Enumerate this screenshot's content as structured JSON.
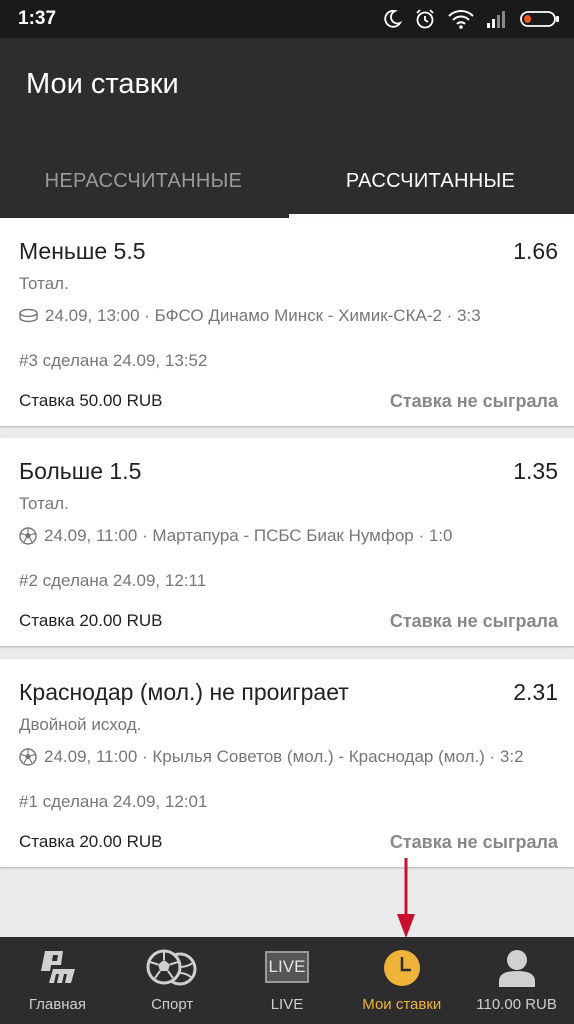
{
  "status_bar": {
    "time": "1:37"
  },
  "header": {
    "title": "Мои ставки"
  },
  "tabs": [
    {
      "label": "НЕРАССЧИТАННЫЕ",
      "selected": false
    },
    {
      "label": "РАССЧИТАННЫЕ",
      "selected": true
    }
  ],
  "bets": [
    {
      "selection": "Меньше 5.5",
      "odds": "1.66",
      "market": "Тотал.",
      "sport_icon": "hockey-puck-icon",
      "event": "24.09, 13:00 · БФСО Динамо Минск - Химик-СКА-2 · 3:3",
      "placed": "#3 сделана 24.09, 13:52",
      "stake": "Ставка 50.00 RUB",
      "result": "Ставка не сыграла"
    },
    {
      "selection": "Больше 1.5",
      "odds": "1.35",
      "market": "Тотал.",
      "sport_icon": "soccer-ball-icon",
      "event": "24.09, 11:00 · Мартапура - ПСБС Биак Нумфор · 1:0",
      "placed": "#2 сделана 24.09, 12:11",
      "stake": "Ставка 20.00 RUB",
      "result": "Ставка не сыграла"
    },
    {
      "selection": "Краснодар (мол.) не проиграет",
      "odds": "2.31",
      "market": "Двойной исход.",
      "sport_icon": "soccer-ball-icon",
      "event": "24.09, 11:00 · Крылья Советов (мол.) - Краснодар (мол.) · 3:2",
      "placed": "#1 сделана 24.09, 12:01",
      "stake": "Ставка 20.00 RUB",
      "result": "Ставка не сыграла"
    }
  ],
  "bottom_nav": [
    {
      "label": "Главная",
      "icon": "pm-logo-icon",
      "active": false
    },
    {
      "label": "Спорт",
      "icon": "sport-balls-icon",
      "active": false
    },
    {
      "label": "LIVE",
      "icon": "live-badge-icon",
      "icon_text": "LIVE",
      "active": false
    },
    {
      "label": "Мои ставки",
      "icon": "clock-icon",
      "active": true
    },
    {
      "label": "110.00 RUB",
      "icon": "user-icon",
      "active": false
    }
  ],
  "colors": {
    "accent": "#f0b33a",
    "header_bg": "#2d2d2d",
    "annotation_arrow": "#c8102e"
  }
}
